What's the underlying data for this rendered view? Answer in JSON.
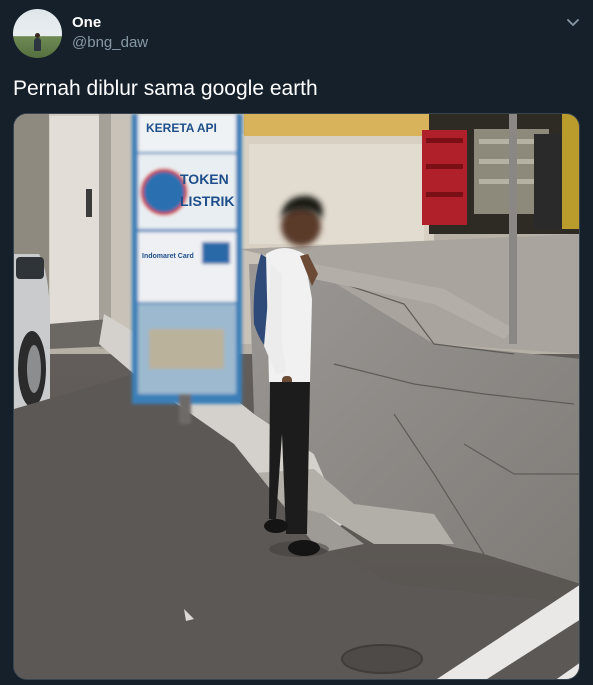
{
  "tweet": {
    "author": {
      "display_name": "One",
      "handle": "@bng_daw"
    },
    "text": "Pernah diblur sama google earth",
    "menu_icon": "chevron-down-icon",
    "media": {
      "sign_lines": [
        "KERETA API",
        "TOKEN",
        "LISTRIK",
        "Indomaret Card"
      ]
    }
  },
  "colors": {
    "background": "#15202b",
    "secondary_text": "#8899a6",
    "border": "#38444d"
  }
}
